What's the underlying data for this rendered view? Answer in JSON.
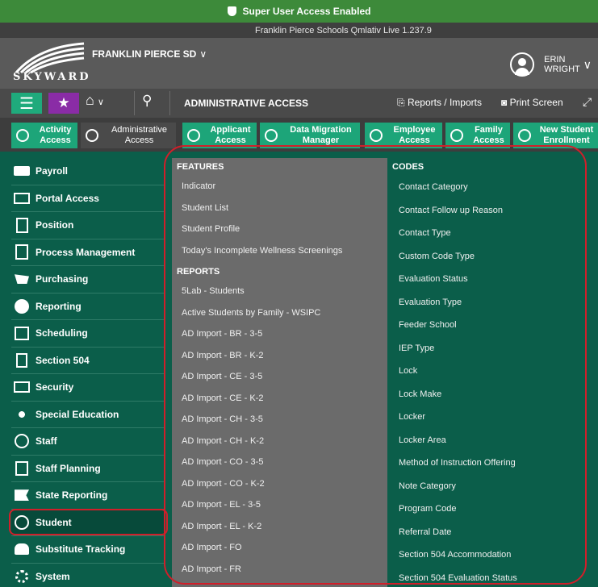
{
  "top_banner": {
    "text": "Super User Access Enabled",
    "icon": "shield-icon"
  },
  "sub_banner": {
    "text": "Franklin Pierce Schools Qmlativ Live 1.237.9"
  },
  "header": {
    "logo_text": "SKYWARD",
    "district": "FRANKLIN PIERCE SD",
    "user_first": "ERIN",
    "user_last": "WRIGHT"
  },
  "navbar": {
    "title": "ADMINISTRATIVE ACCESS",
    "reports_label": "Reports / Imports",
    "print_label": "Print Screen"
  },
  "tiles": [
    {
      "label": "Activity Access"
    },
    {
      "label": "Administrative Access"
    },
    {
      "label": "Applicant Access"
    },
    {
      "label": "Data Migration Manager"
    },
    {
      "label": "Employee Access"
    },
    {
      "label": "Family Access"
    },
    {
      "label": "New Student Enrollment"
    }
  ],
  "sidebar": {
    "items": [
      {
        "label": "Payroll"
      },
      {
        "label": "Portal Access"
      },
      {
        "label": "Position"
      },
      {
        "label": "Process Management"
      },
      {
        "label": "Purchasing"
      },
      {
        "label": "Reporting"
      },
      {
        "label": "Scheduling"
      },
      {
        "label": "Section 504"
      },
      {
        "label": "Security"
      },
      {
        "label": "Special Education"
      },
      {
        "label": "Staff"
      },
      {
        "label": "Staff Planning"
      },
      {
        "label": "State Reporting"
      },
      {
        "label": "Student"
      },
      {
        "label": "Substitute Tracking"
      },
      {
        "label": "System"
      }
    ],
    "active": "Student"
  },
  "features": {
    "heading": "FEATURES",
    "items": [
      "Indicator",
      "Student List",
      "Student Profile",
      "Today's Incomplete Wellness Screenings"
    ]
  },
  "reports": {
    "heading": "REPORTS",
    "items": [
      "5Lab - Students",
      "Active Students by Family - WSIPC",
      "AD Import - BR - 3-5",
      "AD Import - BR - K-2",
      "AD Import - CE - 3-5",
      "AD Import - CE - K-2",
      "AD Import - CH - 3-5",
      "AD Import - CH - K-2",
      "AD Import - CO - 3-5",
      "AD Import - CO - K-2",
      "AD Import - EL - 3-5",
      "AD Import - EL - K-2",
      "AD Import - FO",
      "AD Import - FR"
    ]
  },
  "codes": {
    "heading": "CODES",
    "items": [
      "Contact Category",
      "Contact Follow up Reason",
      "Contact Type",
      "Custom Code Type",
      "Evaluation Status",
      "Evaluation Type",
      "Feeder School",
      "IEP Type",
      "Lock",
      "Lock Make",
      "Locker",
      "Locker Area",
      "Method of Instruction Offering",
      "Note Category",
      "Program Code",
      "Referral Date",
      "Section 504 Accommodation",
      "Section 504 Evaluation Status"
    ]
  },
  "colors": {
    "banner_green": "#3d8a3a",
    "main_green": "#0b5e4a",
    "tile_green": "#1da579",
    "favorites_purple": "#8a2ca6",
    "highlight_red": "#d11f2a"
  }
}
